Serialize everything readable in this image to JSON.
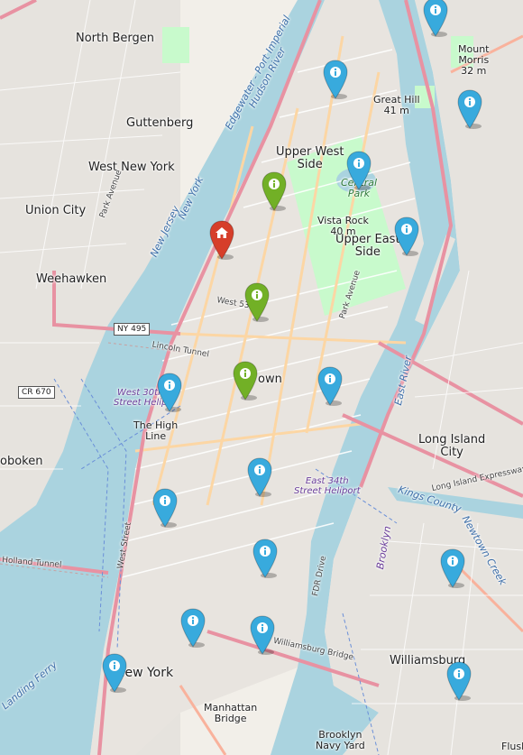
{
  "colors": {
    "water": "#aad3df",
    "land": "#f2efe9",
    "park": "#c8facc",
    "urban": "#e0dfdf",
    "major_road": "#fcd6a4",
    "highway": "#e892a2",
    "marker_blue": "#38aadd",
    "marker_green": "#72b026",
    "marker_red": "#d63e2a"
  },
  "labels": {
    "north_bergen": "North Bergen",
    "guttenberg": "Guttenberg",
    "west_new_york": "West New York",
    "union_city": "Union City",
    "weehawken": "Weehawken",
    "hoboken": "oboken",
    "upper_west_side": "Upper West\nSide",
    "central_park": "Central\nPark",
    "upper_east_side": "Upper East\nSide",
    "great_hill": "Great Hill\n41 m",
    "vista_rock": "Vista Rock\n40 m",
    "mount_morris": "Mount\nMorris\n32 m",
    "midtown": "own",
    "long_island_city": "Long Island\nCity",
    "new_york": "New York",
    "manhattan_bridge": "Manhattan\nBridge",
    "williamsburg": "Williamsburg",
    "the_high_line": "The High\nLine",
    "hudson_river": "Edgewater - Port Imperial\nHudson River",
    "east_river": "East River",
    "new_jersey": "New Jersey",
    "new_york_river": "New York",
    "heliport_west": "West 30th\nStreet Helip",
    "heliport_east": "East 34th\nStreet Heliport",
    "ny495": "NY 495",
    "cr670": "CR 670",
    "lincoln_tunnel": "Lincoln Tunnel",
    "holland_tunnel": "Holland Tunnel",
    "park_avenue": "Park Avenue",
    "west_street": "West Street",
    "fdr_drive": "FDR Drive",
    "kings_county": "Kings County",
    "brooklyn": "Brooklyn",
    "brooklyn_navy_yard": "Brooklyn\nNavy Yard",
    "long_island_expressway": "Long Island Expressway",
    "williamsburg_bridge": "Williamsburg Bridge",
    "west_53rd": "West 53rd",
    "newtown_creek": "Newtown Creek",
    "flushing": "Flush",
    "landing_ferry": "Landing Ferry"
  },
  "markers": [
    {
      "name": "marker-blue-1",
      "color": "blue",
      "icon": "info-icon"
    },
    {
      "name": "marker-blue-2",
      "color": "blue",
      "icon": "info-icon"
    },
    {
      "name": "marker-blue-3",
      "color": "blue",
      "icon": "info-icon"
    },
    {
      "name": "marker-blue-4",
      "color": "blue",
      "icon": "info-icon"
    },
    {
      "name": "marker-blue-5",
      "color": "blue",
      "icon": "info-icon"
    },
    {
      "name": "marker-blue-6",
      "color": "blue",
      "icon": "info-icon"
    },
    {
      "name": "marker-blue-7",
      "color": "blue",
      "icon": "info-icon"
    },
    {
      "name": "marker-blue-8",
      "color": "blue",
      "icon": "info-icon"
    },
    {
      "name": "marker-blue-9",
      "color": "blue",
      "icon": "info-icon"
    },
    {
      "name": "marker-blue-10",
      "color": "blue",
      "icon": "info-icon"
    },
    {
      "name": "marker-blue-11",
      "color": "blue",
      "icon": "info-icon"
    },
    {
      "name": "marker-blue-12",
      "color": "blue",
      "icon": "info-icon"
    },
    {
      "name": "marker-blue-13",
      "color": "blue",
      "icon": "info-icon"
    },
    {
      "name": "marker-blue-14",
      "color": "blue",
      "icon": "info-icon"
    },
    {
      "name": "marker-blue-15",
      "color": "blue",
      "icon": "info-icon"
    },
    {
      "name": "marker-blue-16",
      "color": "blue",
      "icon": "info-icon"
    },
    {
      "name": "marker-green-1",
      "color": "green",
      "icon": "info-icon"
    },
    {
      "name": "marker-green-2",
      "color": "green",
      "icon": "info-icon"
    },
    {
      "name": "marker-green-3",
      "color": "green",
      "icon": "info-icon"
    },
    {
      "name": "marker-red-home",
      "color": "red",
      "icon": "home-icon"
    }
  ]
}
